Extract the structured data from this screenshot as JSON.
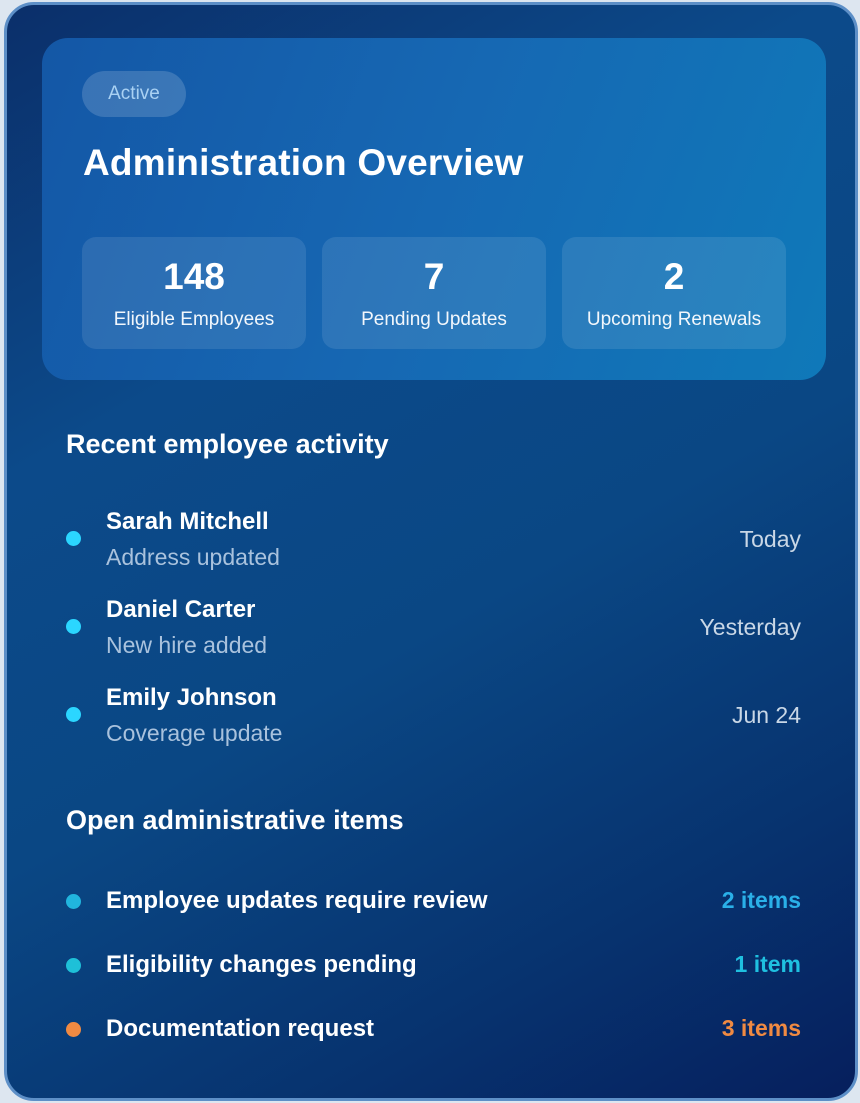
{
  "colors": {
    "dot_cyan": "#2bd6ff",
    "dot_teal": "#21b5de",
    "dot_aqua": "#1ec0d8",
    "dot_orange": "#f08a42",
    "count_blue": "#2ab0e8",
    "count_cyan": "#1fc0e0",
    "count_orange": "#f08a42"
  },
  "hero": {
    "badge": "Active",
    "title": "Administration Overview",
    "stats": [
      {
        "value": "148",
        "label": "Eligible Employees"
      },
      {
        "value": "7",
        "label": "Pending Updates"
      },
      {
        "value": "2",
        "label": "Upcoming Renewals"
      }
    ]
  },
  "activity": {
    "title": "Recent employee activity",
    "items": [
      {
        "name": "Sarah Mitchell",
        "description": "Address updated",
        "date": "Today"
      },
      {
        "name": "Daniel Carter",
        "description": "New hire added",
        "date": "Yesterday"
      },
      {
        "name": "Emily Johnson",
        "description": "Coverage update",
        "date": "Jun 24"
      }
    ]
  },
  "open_items": {
    "title": "Open administrative items",
    "items": [
      {
        "label": "Employee updates require review",
        "count": "2 items"
      },
      {
        "label": "Eligibility changes pending",
        "count": "1 item"
      },
      {
        "label": "Documentation request",
        "count": "3 items"
      }
    ]
  }
}
